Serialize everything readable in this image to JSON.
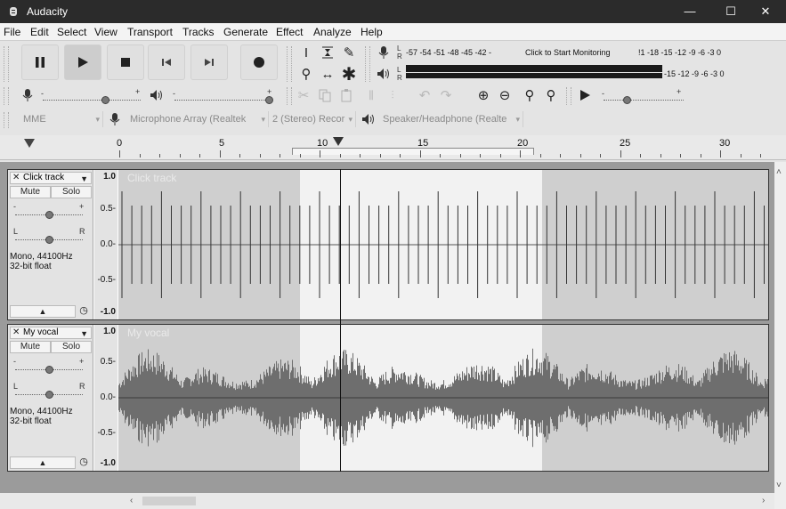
{
  "window": {
    "title": "Audacity",
    "minimize": "—",
    "maximize": "☐",
    "close": "✕"
  },
  "menu": [
    "File",
    "Edit",
    "Select",
    "View",
    "Transport",
    "Tracks",
    "Generate",
    "Effect",
    "Analyze",
    "Help"
  ],
  "meters": {
    "scale": "-57 -54 -51 -48 -45 -42 -",
    "record_hint": "Click to Start Monitoring",
    "record_scale_right": "!1 -18 -15 -12  -9  -6  -3  0",
    "play_scale_right": "-15 -12  -9  -6  -3  0",
    "left": "L",
    "right": "R"
  },
  "device": {
    "host": "MME",
    "mic": "Microphone Array (Realtek",
    "channels": "2 (Stereo) Recor",
    "speaker": "Speaker/Headphone (Realte"
  },
  "ruler": {
    "labels": [
      "0",
      "5",
      "10",
      "15",
      "20",
      "25",
      "30"
    ]
  },
  "tracks": [
    {
      "name": "Click track",
      "mute": "Mute",
      "solo": "Solo",
      "gain_minus": "-",
      "gain_plus": "+",
      "pan_left": "L",
      "pan_right": "R",
      "info_rate": "Mono, 44100Hz",
      "info_format": "32-bit float",
      "ruler": [
        "1.0",
        "0.5-",
        "0.0-",
        "-0.5-",
        "-1.0"
      ],
      "overlay": "Click track"
    },
    {
      "name": "My vocal",
      "mute": "Mute",
      "solo": "Solo",
      "gain_minus": "-",
      "gain_plus": "+",
      "pan_left": "L",
      "pan_right": "R",
      "info_rate": "Mono, 44100Hz",
      "info_format": "32-bit float",
      "ruler": [
        "1.0",
        "0.5-",
        "0.0-",
        "-0.5-",
        "-1.0"
      ],
      "overlay": "My vocal"
    }
  ],
  "colors": {
    "titlebar": "#2b2b2b",
    "wave_bg": "#cfcfcf",
    "selection_bg": "#f2f2f2",
    "waveform": "#6e6e6e",
    "record": "#222222"
  }
}
